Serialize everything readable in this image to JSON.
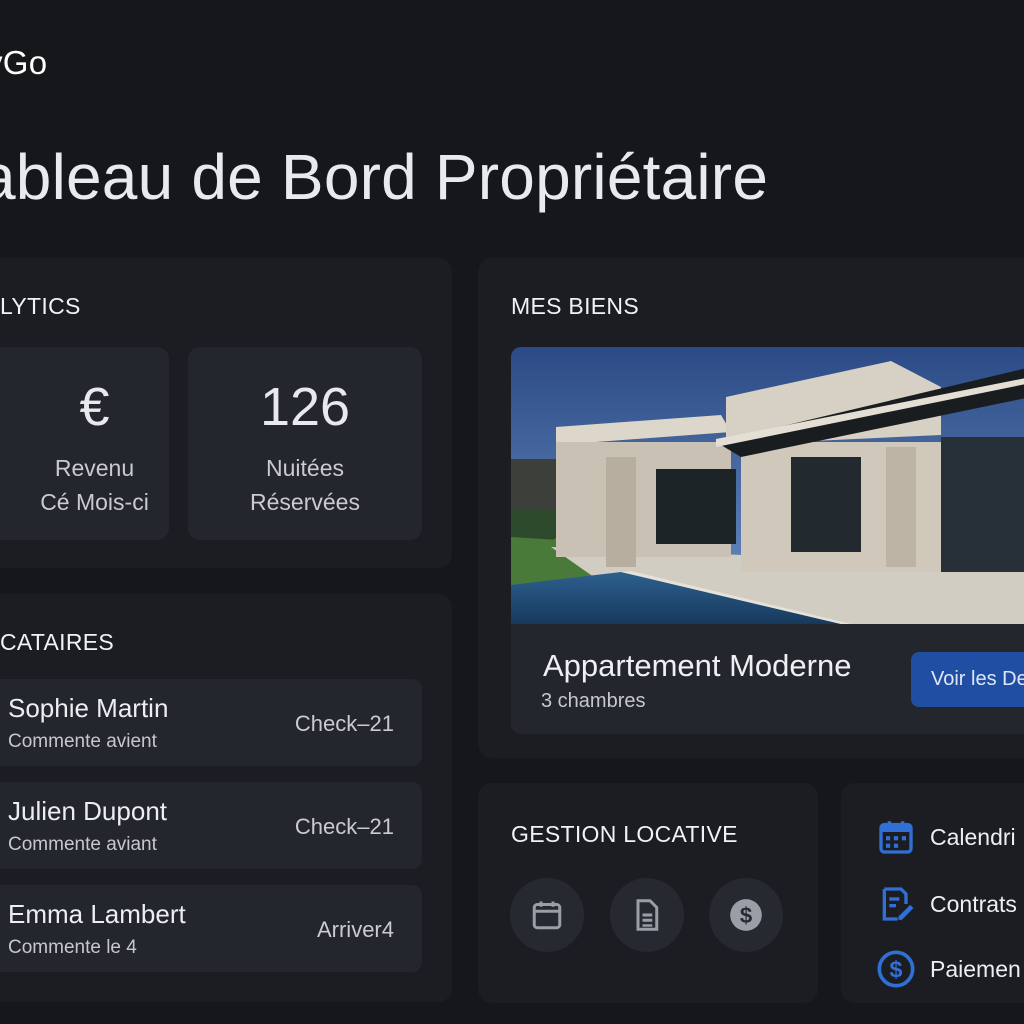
{
  "brand": "yGo",
  "page_title": "ableau de Bord Propriétaire",
  "analytics": {
    "heading": "LYTICS",
    "stats": [
      {
        "value": "€",
        "label_line1": "Revenu",
        "label_line2": "Cé Mois-ci"
      },
      {
        "value": "126",
        "label_line1": "Nuitées",
        "label_line2": "Réservées"
      }
    ]
  },
  "tenants": {
    "heading": "CATAIRES",
    "items": [
      {
        "name": "Sophie Martin",
        "note": "Commente avient",
        "status": "Check–21"
      },
      {
        "name": "Julien Dupont",
        "note": "Commente aviant",
        "status": "Check–21"
      },
      {
        "name": "Emma Lambert",
        "note": "Commente le 4",
        "status": "Arriver4"
      }
    ]
  },
  "properties": {
    "heading": "MES BIENS",
    "featured": {
      "title": "Appartement Moderne",
      "subtitle": "3 chambres",
      "button_label": "Voir les De"
    }
  },
  "gestion": {
    "heading": "GESTION LOCATIVE",
    "actions": [
      {
        "icon": "calendar-icon"
      },
      {
        "icon": "document-icon"
      },
      {
        "icon": "dollar-icon"
      }
    ]
  },
  "quick_links": [
    {
      "icon": "calendar-icon",
      "label": "Calendri"
    },
    {
      "icon": "contract-edit-icon",
      "label": "Contrats"
    },
    {
      "icon": "dollar-icon",
      "label": "Paiemen"
    }
  ],
  "colors": {
    "background": "#15171b",
    "card": "#1b1d22",
    "inner_card": "#23262c",
    "accent_blue": "#1f4ea3",
    "icon_blue": "#2f6fd6"
  }
}
